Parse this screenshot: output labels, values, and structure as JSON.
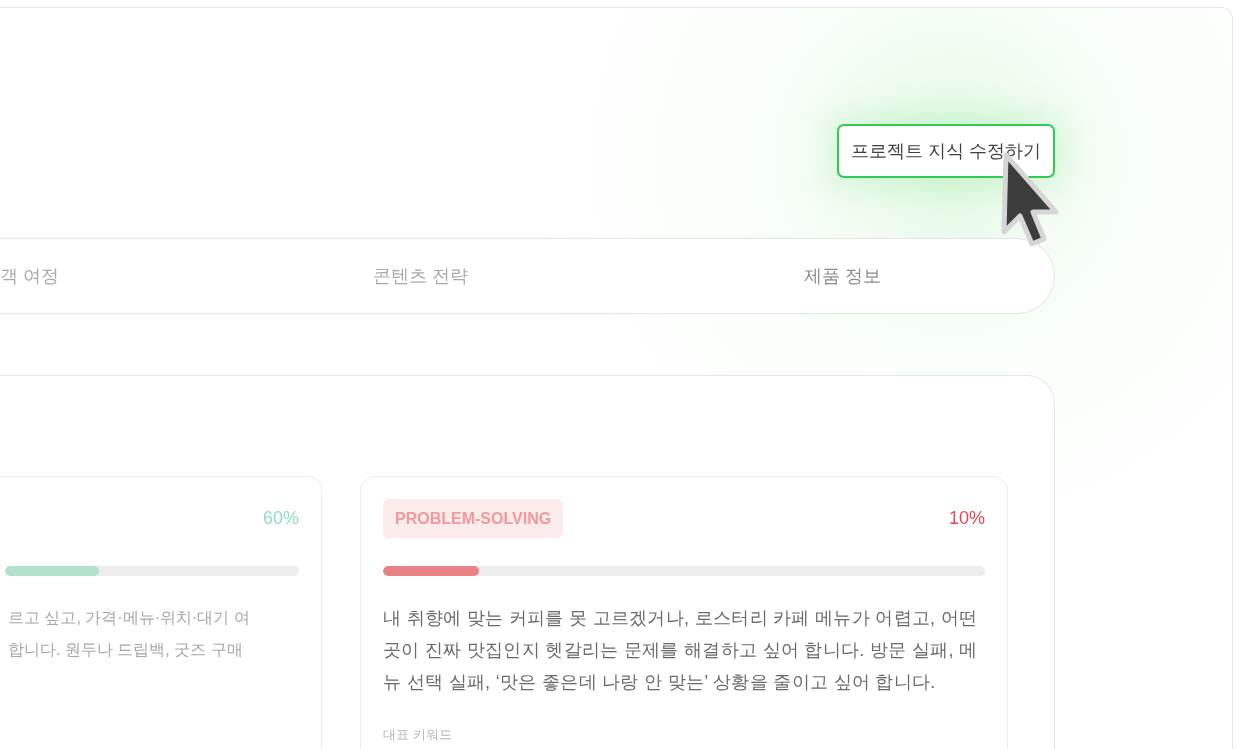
{
  "edit_button": "프로젝트 지식 수정하기",
  "tabs": [
    {
      "label": "객 여정"
    },
    {
      "label": "콘텐츠 전략"
    },
    {
      "label": "제품 정보"
    }
  ],
  "cards": [
    {
      "percent": "60%",
      "color": "#8fdcbc",
      "level": 0.32,
      "description": "르고 싶고, 가격·메뉴·위치·대기 여\n합니다. 원두나 드립백, 굿즈 구매"
    },
    {
      "tag": "PROBLEM-SOLVING",
      "percent": "10%",
      "color": "#e5484d",
      "level": 0.16,
      "description": "내 취향에 맞는 커피를 못 고르겠거나, 로스터리 카페 메뉴가 어렵고, 어떤 곳이 진짜 맛집인지 헷갈리는 문제를 해결하고 싶어 합니다. 방문 실패, 메뉴 선택 실패, ‘맛은 좋은데 나랑 안 맞는’ 상황을 줄이고 싶어 합니다.",
      "section_label": "대표 키워드"
    }
  ]
}
